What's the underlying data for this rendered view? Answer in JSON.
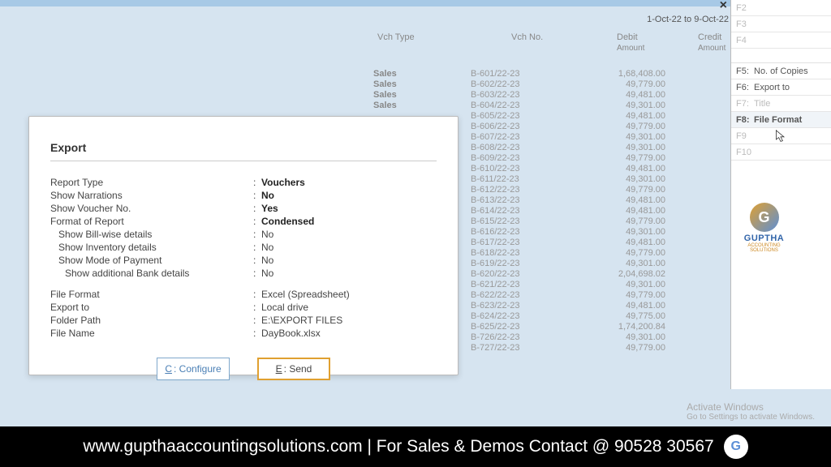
{
  "header": {
    "date_range": "1-Oct-22 to 9-Oct-22",
    "close": "×"
  },
  "columns": {
    "vch_type": "Vch Type",
    "vch_no": "Vch No.",
    "debit": "Debit",
    "credit": "Credit",
    "amount": "Amount"
  },
  "rows": [
    {
      "type": "Sales",
      "no": "B-601/22-23",
      "debit": "1,68,408.00",
      "credit": ""
    },
    {
      "type": "Sales",
      "no": "B-602/22-23",
      "debit": "49,779.00",
      "credit": ""
    },
    {
      "type": "Sales",
      "no": "B-603/22-23",
      "debit": "49,481.00",
      "credit": ""
    },
    {
      "type": "Sales",
      "no": "B-604/22-23",
      "debit": "49,301.00",
      "credit": ""
    },
    {
      "type": "",
      "no": "B-605/22-23",
      "debit": "49,481.00",
      "credit": ""
    },
    {
      "type": "",
      "no": "B-606/22-23",
      "debit": "49,779.00",
      "credit": ""
    },
    {
      "type": "",
      "no": "B-607/22-23",
      "debit": "49,301.00",
      "credit": ""
    },
    {
      "type": "",
      "no": "B-608/22-23",
      "debit": "49,301.00",
      "credit": ""
    },
    {
      "type": "",
      "no": "B-609/22-23",
      "debit": "49,779.00",
      "credit": ""
    },
    {
      "type": "",
      "no": "B-610/22-23",
      "debit": "49,481.00",
      "credit": ""
    },
    {
      "type": "",
      "no": "B-611/22-23",
      "debit": "49,301.00",
      "credit": ""
    },
    {
      "type": "",
      "no": "B-612/22-23",
      "debit": "49,779.00",
      "credit": ""
    },
    {
      "type": "",
      "no": "B-613/22-23",
      "debit": "49,481.00",
      "credit": ""
    },
    {
      "type": "",
      "no": "B-614/22-23",
      "debit": "49,481.00",
      "credit": ""
    },
    {
      "type": "",
      "no": "B-615/22-23",
      "debit": "49,779.00",
      "credit": ""
    },
    {
      "type": "",
      "no": "B-616/22-23",
      "debit": "49,301.00",
      "credit": ""
    },
    {
      "type": "",
      "no": "B-617/22-23",
      "debit": "49,481.00",
      "credit": ""
    },
    {
      "type": "",
      "no": "B-618/22-23",
      "debit": "49,779.00",
      "credit": ""
    },
    {
      "type": "",
      "no": "B-619/22-23",
      "debit": "49,301.00",
      "credit": ""
    },
    {
      "type": "",
      "no": "B-620/22-23",
      "debit": "2,04,698.02",
      "credit": ""
    },
    {
      "type": "",
      "no": "B-621/22-23",
      "debit": "49,301.00",
      "credit": ""
    },
    {
      "type": "",
      "no": "B-622/22-23",
      "debit": "49,779.00",
      "credit": ""
    },
    {
      "type": "",
      "no": "B-623/22-23",
      "debit": "49,481.00",
      "credit": ""
    },
    {
      "type": "",
      "no": "B-624/22-23",
      "debit": "49,775.00",
      "credit": ""
    },
    {
      "type": "",
      "no": "B-625/22-23",
      "debit": "1,74,200.84",
      "credit": ""
    },
    {
      "type": "",
      "no": "B-726/22-23",
      "debit": "49,301.00",
      "credit": ""
    },
    {
      "type": "",
      "no": "B-727/22-23",
      "debit": "49,779.00",
      "credit": ""
    }
  ],
  "modal": {
    "title": "Export",
    "fields": {
      "report_type": {
        "label": "Report Type",
        "value": "Vouchers"
      },
      "show_narr": {
        "label": "Show Narrations",
        "value": "No"
      },
      "show_vno": {
        "label": "Show Voucher No.",
        "value": "Yes"
      },
      "format": {
        "label": "Format of Report",
        "value": "Condensed"
      },
      "bill": {
        "label": "Show Bill-wise details",
        "value": "No"
      },
      "inv": {
        "label": "Show Inventory details",
        "value": "No"
      },
      "mode": {
        "label": "Show Mode of Payment",
        "value": "No"
      },
      "bank": {
        "label": "Show additional Bank details",
        "value": "No"
      },
      "ff": {
        "label": "File Format",
        "value": "Excel (Spreadsheet)"
      },
      "exp": {
        "label": "Export to",
        "value": "Local drive"
      },
      "folder": {
        "label": "Folder Path",
        "value": "E:\\EXPORT FILES"
      },
      "fname": {
        "label": "File Name",
        "value": "DayBook.xlsx"
      }
    },
    "buttons": {
      "configure_key": "C",
      "configure": ": Configure",
      "send_key": "E",
      "send": ": Send"
    }
  },
  "right": {
    "f2": "F2",
    "f3": "F3",
    "f4": "F4",
    "f5_k": "F5:",
    "f5_t": "No. of Copies",
    "f6_k": "F6:",
    "f6_t": "Export to",
    "f7_k": "F7:",
    "f7_t": "Title",
    "f8_k": "F8:",
    "f8_t": "File Format",
    "f9": "F9",
    "f10": "F10"
  },
  "logo": {
    "g": "G",
    "text": "GUPTHA",
    "sub": "ACCOUNTING SOLUTIONS"
  },
  "activate": {
    "title": "Activate Windows",
    "sub": "Go to Settings to activate Windows."
  },
  "footer": {
    "text": "www.gupthaaccountingsolutions.com | For Sales & Demos Contact @ 90528 30567",
    "g": "G"
  }
}
